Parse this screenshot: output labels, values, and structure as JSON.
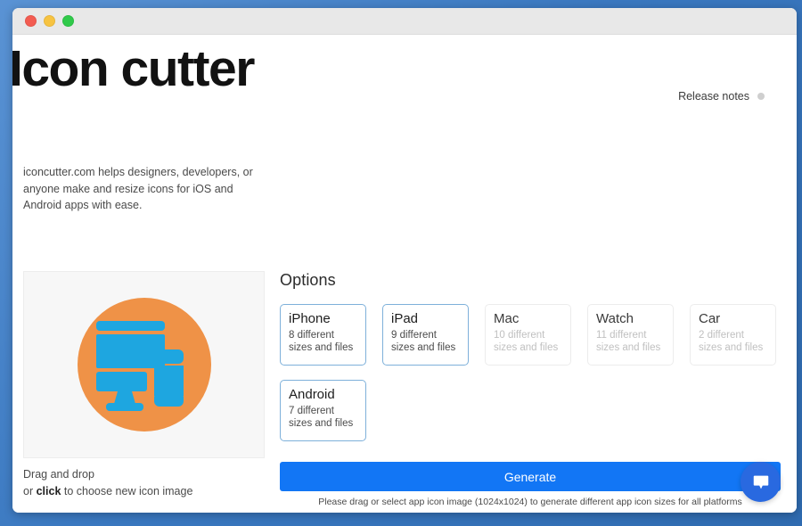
{
  "window": {
    "traffic_lights": [
      {
        "name": "close",
        "color": "#f35c51"
      },
      {
        "name": "minimize",
        "color": "#f7c341"
      },
      {
        "name": "zoom",
        "color": "#30ca4a"
      }
    ]
  },
  "header": {
    "title": "Icon cutter",
    "release_notes_label": "Release notes",
    "description": "iconcutter.com helps designers, developers, or anyone make and resize icons for iOS and Android apps with ease."
  },
  "preview": {
    "icon_name": "devices-monitor-phone-icon",
    "circle_color": "#ef9247",
    "device_color": "#1ea6e0",
    "dropzone_line1": "Drag and drop",
    "dropzone_line2_prefix": "or ",
    "dropzone_line2_bold": "click",
    "dropzone_line2_suffix": " to choose new icon image"
  },
  "options": {
    "title": "Options",
    "cards": [
      {
        "name": "iPhone",
        "sub": "8 different sizes and files",
        "selected": true
      },
      {
        "name": "iPad",
        "sub": "9 different sizes and files",
        "selected": true
      },
      {
        "name": "Mac",
        "sub": "10 different sizes and files",
        "selected": false
      },
      {
        "name": "Watch",
        "sub": "11 different sizes and files",
        "selected": false
      },
      {
        "name": "Car",
        "sub": "2 different sizes and files",
        "selected": false
      },
      {
        "name": "Android",
        "sub": "7 different sizes and files",
        "selected": true
      }
    ]
  },
  "actions": {
    "generate_label": "Generate",
    "generate_hint": "Please drag or select app icon image (1024x1024) to generate different app icon sizes for all platforms",
    "generate_color": "#1276f5"
  },
  "chat": {
    "icon_name": "chat-bubble-icon",
    "color": "#2969e0"
  }
}
